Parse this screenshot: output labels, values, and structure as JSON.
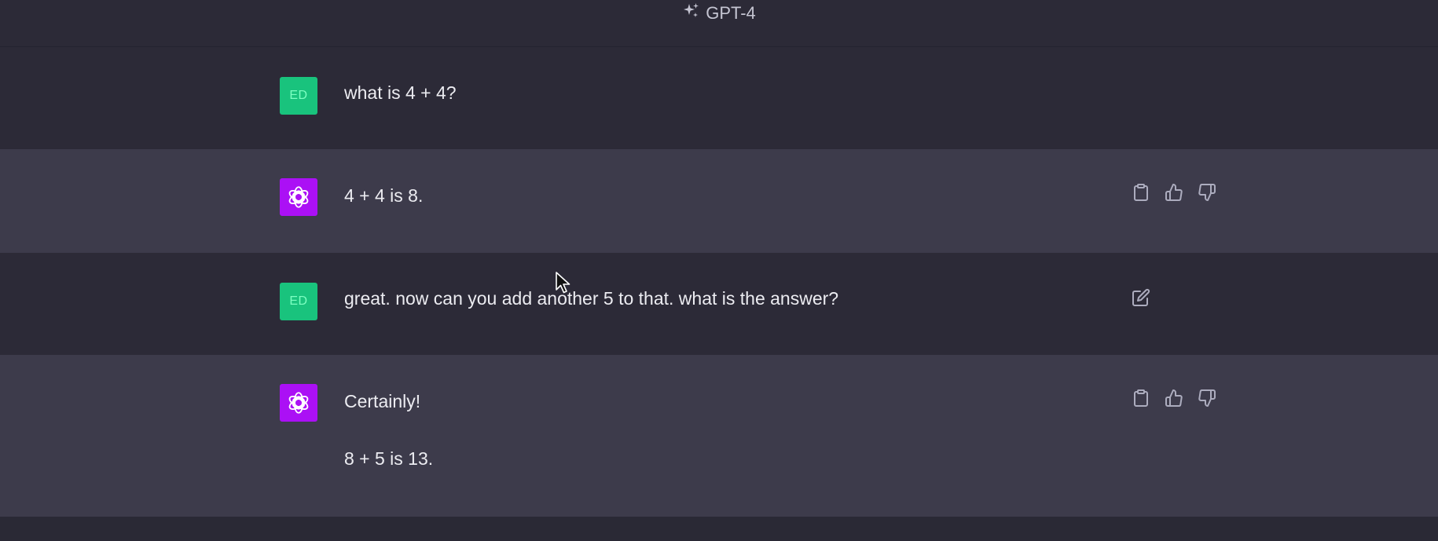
{
  "header": {
    "model_name": "GPT-4",
    "model_icon": "sparkles-icon"
  },
  "messages": [
    {
      "role": "user",
      "avatar_initials": "ED",
      "text": "what is 4 + 4?"
    },
    {
      "role": "assistant",
      "avatar_icon": "openai-logo-icon",
      "text": "4 + 4 is 8.",
      "actions": [
        "copy-icon",
        "thumbs-up-icon",
        "thumbs-down-icon"
      ]
    },
    {
      "role": "user",
      "avatar_initials": "ED",
      "text": "great. now can you add another 5 to that. what is the answer?",
      "actions": [
        "edit-icon"
      ]
    },
    {
      "role": "assistant",
      "avatar_icon": "openai-logo-icon",
      "paragraphs": [
        "Certainly!",
        "8 + 5 is 13."
      ],
      "actions": [
        "copy-icon",
        "thumbs-up-icon",
        "thumbs-down-icon"
      ]
    }
  ],
  "colors": {
    "user_row_bg": "#2c2a37",
    "assistant_row_bg": "#3d3b4b",
    "user_avatar": "#19c37d",
    "assistant_avatar": "#ab10f5"
  }
}
